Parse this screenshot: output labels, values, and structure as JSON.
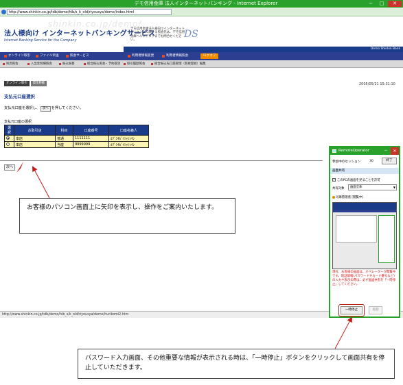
{
  "browser": {
    "title": "デモ信用金庫  法人インターネットバンキング - Internet Explorer",
    "url": "http://www.shinkin.co.jp/tdb/demo/hib/s_k_old/riyousya/demo/index.html",
    "controls": {
      "minimize": "−",
      "maximize": "□",
      "close": "✕"
    }
  },
  "header": {
    "watermark": "shinkin.co.jp/demo/",
    "bank_title": "法人様向け インターネットバンキングサービス",
    "bank_subtitle": "Internet Banking Service for the Company",
    "notice": "デモ信用金庫法人様向けインターネットバンキングに関する照会先は、デモ信用金庫ヘルプデスクまでお問合せください。",
    "ds_logo": "DS",
    "bank_name_en": "Demo Shinkin Bank"
  },
  "menu": {
    "items": [
      "オンライン取引",
      "ファイル伝送",
      "照会サービス",
      "利用者情報変更",
      "利用者情報照会"
    ],
    "help": "ログオフ"
  },
  "submenu": {
    "items": [
      "残高照会",
      "入出金明細照会",
      "振込振替",
      "総合振込照会・予約取消",
      "取引履歴照会",
      "総合振込先口座管理（新規登録）編集"
    ]
  },
  "breadcrumb": {
    "items": [
      "オンライン取引",
      "資金移動"
    ]
  },
  "timestamp": "2005/05/21 15:31:10",
  "page": {
    "heading": "支払元口座選択",
    "instruction_prefix": "支払元口座を選択し、",
    "instruction_button": "次へ",
    "instruction_suffix": "を押してください。",
    "table_caption": "支払元口座の選択",
    "next_button": "次へ"
  },
  "accounts": {
    "headers": [
      "選択",
      "お取引店",
      "科目",
      "口座番号",
      "口座名義人"
    ],
    "rows": [
      {
        "selected": true,
        "branch": "本店",
        "type": "普通",
        "number": "1111111",
        "holder": "ｶﾌﾞｼｷｶﾞｲｼｬｼﾝｷﾝ"
      },
      {
        "selected": false,
        "branch": "本店",
        "type": "当座",
        "number": "9999999",
        "holder": "ｶﾌﾞｼｷｶﾞｲｼｬｼﾝｷﾝ"
      }
    ]
  },
  "statusbar": "http://www.shinkin.co.jp/tdb/demo/hib_s/k_old/riyousya/demo/hurikomi2.htm",
  "remote_operator": {
    "title": "RemoteOperator",
    "session_label": "参加中のセッション",
    "session_count": "30",
    "end_button": "終了",
    "section": "画面共有",
    "allow_checkbox": "このPCの画面を見ることを許可",
    "allow_checked": true,
    "target_label": "共有対象",
    "target_value": "画面全体",
    "status_label": "司琢管理者",
    "status_value": "[閲覧中]",
    "warning": "現在、お客様の画面は、オペレーターが閲覧中です。暗証情報(パスワードやカード番号など)の入力や表示の際は、必ず画面共有を「一時停止」してください。",
    "pause_button": "一時停止",
    "resume_button": "再開"
  },
  "callouts": {
    "first": "お客様のパソコン画面上に矢印を表示し、操作をご案内いたします。",
    "second": "パスワード入力画面、その他重要な情報が表示される時は、「一時停止」ボタンをクリックして画面共有を停止していただきます。"
  },
  "colors": {
    "titlebar": "#2aa12a",
    "brand_navy": "#1a3a8a",
    "table_cell": "#fdf5b3",
    "warning": "#d01010",
    "arrow": "#c41a1a"
  }
}
